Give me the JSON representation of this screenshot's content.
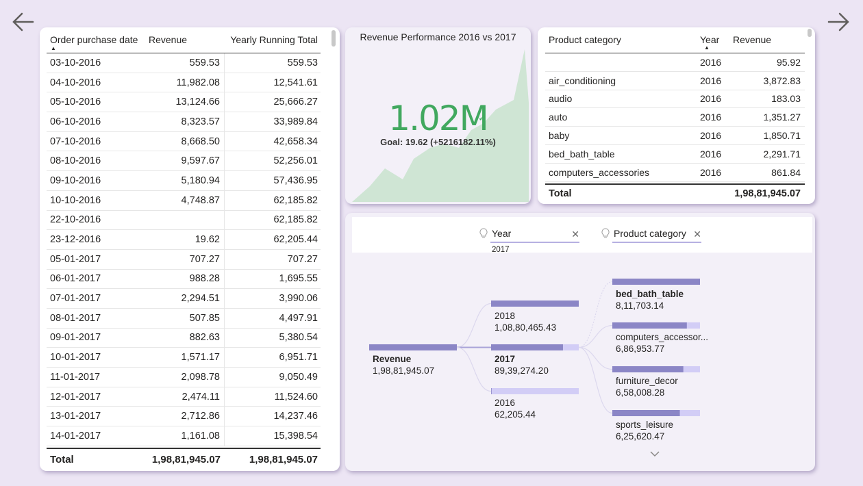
{
  "nav": {
    "back": "back-arrow",
    "forward": "forward-arrow"
  },
  "left_table": {
    "headers": [
      "Order purchase date",
      "Revenue",
      "Yearly Running Total"
    ],
    "rows": [
      [
        "03-10-2016",
        "559.53",
        "559.53"
      ],
      [
        "04-10-2016",
        "11,982.08",
        "12,541.61"
      ],
      [
        "05-10-2016",
        "13,124.66",
        "25,666.27"
      ],
      [
        "06-10-2016",
        "8,323.57",
        "33,989.84"
      ],
      [
        "07-10-2016",
        "8,668.50",
        "42,658.34"
      ],
      [
        "08-10-2016",
        "9,597.67",
        "52,256.01"
      ],
      [
        "09-10-2016",
        "5,180.94",
        "57,436.95"
      ],
      [
        "10-10-2016",
        "4,748.87",
        "62,185.82"
      ],
      [
        "22-10-2016",
        "",
        "62,185.82"
      ],
      [
        "23-12-2016",
        "19.62",
        "62,205.44"
      ],
      [
        "05-01-2017",
        "707.27",
        "707.27"
      ],
      [
        "06-01-2017",
        "988.28",
        "1,695.55"
      ],
      [
        "07-01-2017",
        "2,294.51",
        "3,990.06"
      ],
      [
        "08-01-2017",
        "507.85",
        "4,497.91"
      ],
      [
        "09-01-2017",
        "882.63",
        "5,380.54"
      ],
      [
        "10-01-2017",
        "1,571.17",
        "6,951.71"
      ],
      [
        "11-01-2017",
        "2,098.78",
        "9,050.49"
      ],
      [
        "12-01-2017",
        "2,474.11",
        "11,524.60"
      ],
      [
        "13-01-2017",
        "2,712.86",
        "14,237.46"
      ],
      [
        "14-01-2017",
        "1,161.08",
        "15,398.54"
      ]
    ],
    "total": [
      "Total",
      "1,98,81,945.07",
      "1,98,81,945.07"
    ]
  },
  "kpi": {
    "title": "Revenue Performance 2016 vs 2017",
    "value": "1.02M",
    "goal": "Goal: 19.62 (+5216182.11%)",
    "status_color": "#41a85f",
    "trend_color": "#cfe5d4"
  },
  "category_table": {
    "headers": [
      "Product category",
      "Year",
      "Revenue"
    ],
    "rows": [
      [
        "",
        "2016",
        "95.92"
      ],
      [
        "air_conditioning",
        "2016",
        "3,872.83"
      ],
      [
        "audio",
        "2016",
        "183.03"
      ],
      [
        "auto",
        "2016",
        "1,351.27"
      ],
      [
        "baby",
        "2016",
        "1,850.71"
      ],
      [
        "bed_bath_table",
        "2016",
        "2,291.71"
      ],
      [
        "computers_accessories",
        "2016",
        "861.84"
      ]
    ],
    "total": [
      "Total",
      "",
      "1,98,81,945.07"
    ]
  },
  "decomposition_tree": {
    "levels": [
      {
        "label": "Year",
        "selected": "2017"
      },
      {
        "label": "Product category",
        "selected": ""
      }
    ],
    "root": {
      "name": "Revenue",
      "value": "1,98,81,945.07",
      "share": 1.0
    },
    "year_nodes": [
      {
        "name": "2018",
        "value": "1,08,80,465.43",
        "share": 1.0
      },
      {
        "name": "2017",
        "value": "89,39,274.20",
        "share": 0.82
      },
      {
        "name": "2016",
        "value": "62,205.44",
        "share": 0.006
      }
    ],
    "category_nodes": [
      {
        "name": "bed_bath_table",
        "value": "8,11,703.14",
        "share": 1.0
      },
      {
        "name": "computers_accessor...",
        "value": "6,86,953.77",
        "share": 0.85
      },
      {
        "name": "furniture_decor",
        "value": "6,58,008.28",
        "share": 0.81
      },
      {
        "name": "sports_leisure",
        "value": "6,25,620.47",
        "share": 0.77
      }
    ],
    "bar_color": "#8b86c6",
    "bar_rest_color": "#d2cdf6"
  }
}
